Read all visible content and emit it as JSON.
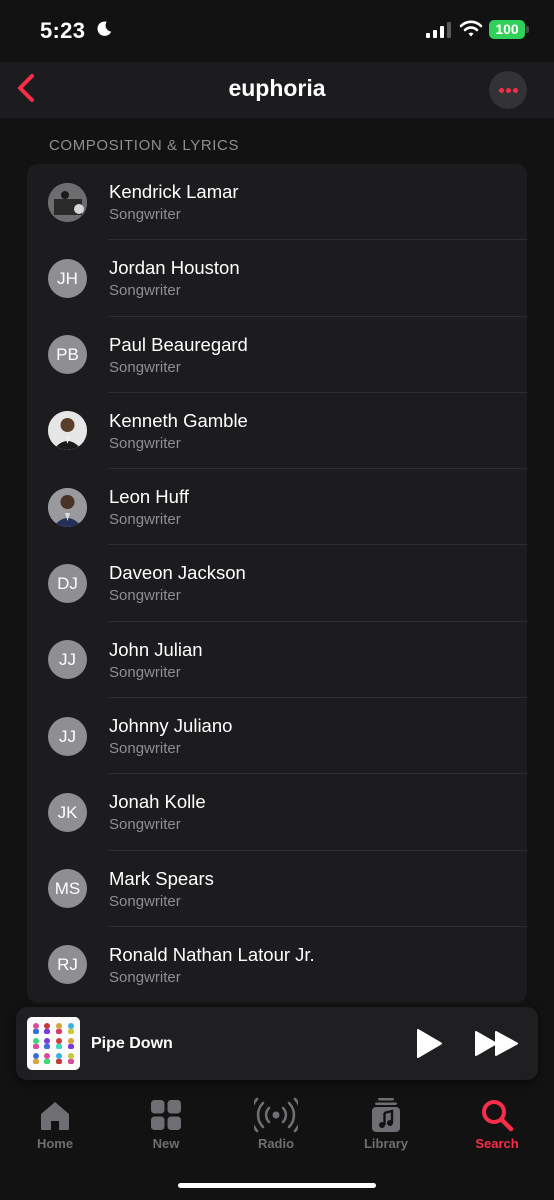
{
  "status_bar": {
    "time": "5:23",
    "battery": "100"
  },
  "colors": {
    "accent": "#fa2d48",
    "battery": "#30d158",
    "secondary_text": "#8e8e93"
  },
  "nav": {
    "title": "euphoria",
    "back_icon": "chevron-left-icon",
    "more_icon": "ellipsis-icon"
  },
  "section": {
    "header": "COMPOSITION & LYRICS"
  },
  "credits": [
    {
      "name": "Kendrick Lamar",
      "role": "Songwriter",
      "initials": ""
    },
    {
      "name": "Jordan Houston",
      "role": "Songwriter",
      "initials": "JH"
    },
    {
      "name": "Paul Beauregard",
      "role": "Songwriter",
      "initials": "PB"
    },
    {
      "name": "Kenneth Gamble",
      "role": "Songwriter",
      "initials": ""
    },
    {
      "name": "Leon Huff",
      "role": "Songwriter",
      "initials": ""
    },
    {
      "name": "Daveon Jackson",
      "role": "Songwriter",
      "initials": "DJ"
    },
    {
      "name": "John Julian",
      "role": "Songwriter",
      "initials": "JJ"
    },
    {
      "name": "Johnny Juliano",
      "role": "Songwriter",
      "initials": "JJ"
    },
    {
      "name": "Jonah Kolle",
      "role": "Songwriter",
      "initials": "JK"
    },
    {
      "name": "Mark Spears",
      "role": "Songwriter",
      "initials": "MS"
    },
    {
      "name": "Ronald Nathan Latour Jr.",
      "role": "Songwriter",
      "initials": "RJ"
    }
  ],
  "player": {
    "track": "Pipe Down"
  },
  "tabs": [
    {
      "label": "Home",
      "icon": "house-icon"
    },
    {
      "label": "New",
      "icon": "grid-icon"
    },
    {
      "label": "Radio",
      "icon": "radio-waves-icon"
    },
    {
      "label": "Library",
      "icon": "library-note-icon"
    },
    {
      "label": "Search",
      "icon": "search-icon",
      "active": true
    }
  ]
}
